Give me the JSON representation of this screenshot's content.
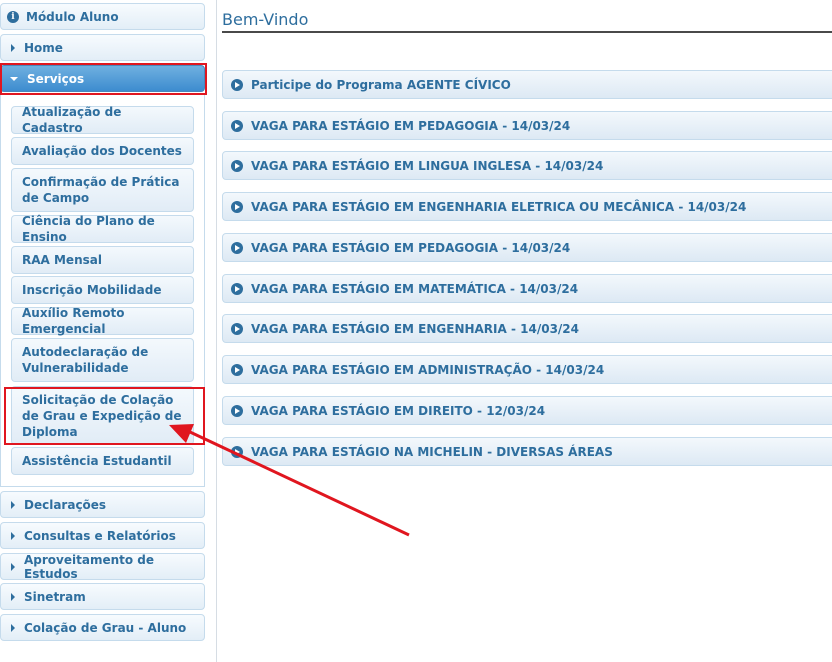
{
  "sidebar": {
    "header_top": {
      "label": "Módulo Aluno",
      "icon": "info-icon"
    },
    "headers_before": [
      {
        "label": "Home"
      },
      {
        "label": "Serviços",
        "active": true
      }
    ],
    "servicos_items": [
      {
        "label": "Atualização de Cadastro"
      },
      {
        "label": "Avaliação dos Docentes"
      },
      {
        "label": "Confirmação de Prática de Campo"
      },
      {
        "label": "Ciência do Plano de Ensino"
      },
      {
        "label": "RAA Mensal"
      },
      {
        "label": "Inscrição Mobilidade"
      },
      {
        "label": "Auxílio Remoto Emergencial"
      },
      {
        "label": "Autodeclaração de Vulnerabilidade"
      },
      {
        "label": "Solicitação de Colação de Grau e Expedição de Diploma",
        "highlighted": true
      },
      {
        "label": "Assistência Estudantil"
      }
    ],
    "headers_after": [
      {
        "label": "Declarações"
      },
      {
        "label": "Consultas e Relatórios"
      },
      {
        "label": "Aproveitamento de Estudos"
      },
      {
        "label": "Sinetram"
      },
      {
        "label": "Colação de Grau - Aluno"
      }
    ]
  },
  "main": {
    "title": "Bem-Vindo",
    "news": [
      {
        "label": "Participe do Programa AGENTE CÍVICO"
      },
      {
        "label": "VAGA PARA ESTÁGIO EM PEDAGOGIA - 14/03/24"
      },
      {
        "label": "VAGA PARA ESTÁGIO EM LINGUA INGLESA - 14/03/24"
      },
      {
        "label": "VAGA PARA ESTÁGIO EM ENGENHARIA ELETRICA OU MECÂNICA - 14/03/24"
      },
      {
        "label": "VAGA PARA ESTÁGIO EM PEDAGOGIA - 14/03/24"
      },
      {
        "label": "VAGA PARA ESTÁGIO EM MATEMÁTICA - 14/03/24"
      },
      {
        "label": "VAGA PARA ESTÁGIO EM ENGENHARIA - 14/03/24"
      },
      {
        "label": "VAGA PARA ESTÁGIO EM ADMINISTRAÇÃO - 14/03/24"
      },
      {
        "label": "VAGA PARA ESTÁGIO EM DIREITO - 12/03/24"
      },
      {
        "label": "VAGA PARA ESTÁGIO NA MICHELIN - DIVERSAS ÁREAS"
      }
    ]
  },
  "colors": {
    "accent": "#2e6e9e",
    "annotation": "#e0161f",
    "active_header": "#3d8ccf"
  }
}
